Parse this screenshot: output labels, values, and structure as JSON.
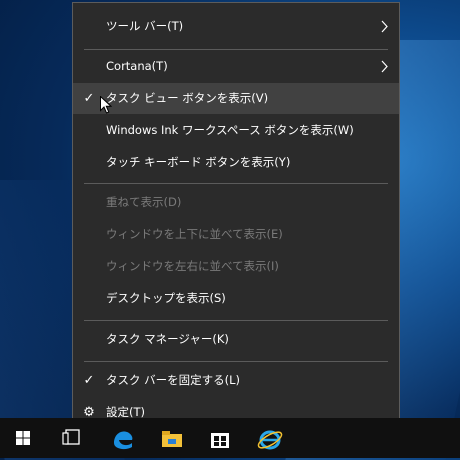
{
  "menu": {
    "toolbar": "ツール バー(T)",
    "cortana": "Cortana(T)",
    "task_view": "タスク ビュー ボタンを表示(V)",
    "ink_workspace": "Windows Ink ワークスペース ボタンを表示(W)",
    "touch_keyboard": "タッチ キーボード ボタンを表示(Y)",
    "cascade": "重ねて表示(D)",
    "stack": "ウィンドウを上下に並べて表示(E)",
    "side_by_side": "ウィンドウを左右に並べて表示(I)",
    "show_desktop": "デスクトップを表示(S)",
    "task_manager": "タスク マネージャー(K)",
    "lock_taskbar": "タスク バーを固定する(L)",
    "settings": "設定(T)"
  },
  "icons": {
    "check": "✓",
    "gear": "⚙"
  },
  "colors": {
    "menu_bg": "#2b2b2b",
    "hover_bg": "#414141",
    "disabled_text": "#7a7a7a",
    "taskbar_bg": "#101010"
  }
}
